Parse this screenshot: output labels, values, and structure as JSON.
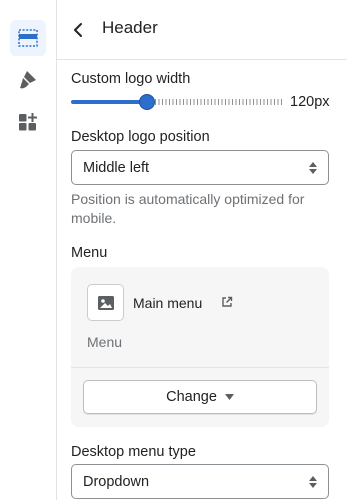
{
  "rail": {
    "items": [
      {
        "name": "header-section-icon",
        "active": true
      },
      {
        "name": "theme-settings-icon",
        "active": false
      },
      {
        "name": "app-blocks-icon",
        "active": false
      }
    ]
  },
  "panel": {
    "title": "Header",
    "logo_width": {
      "label": "Custom logo width",
      "value_label": "120px",
      "fraction": 0.36
    },
    "desktop_logo_position": {
      "label": "Desktop logo position",
      "value": "Middle left",
      "help": "Position is automatically optimized for mobile."
    },
    "menu": {
      "label": "Menu",
      "name": "Main menu",
      "subtitle": "Menu",
      "change_label": "Change"
    },
    "desktop_menu_type": {
      "label": "Desktop menu type",
      "value": "Dropdown"
    }
  },
  "colors": {
    "accent": "#2c6ecb",
    "text": "#202223",
    "subdued": "#6d7175",
    "card_bg": "#f6f6f7"
  }
}
